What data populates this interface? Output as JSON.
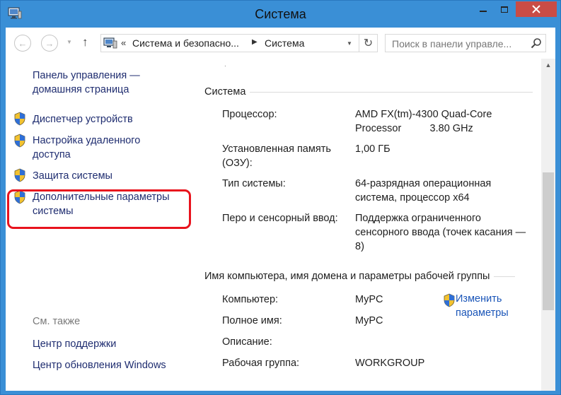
{
  "window": {
    "title": "Система",
    "colors": {
      "frame": "#3a8fd6",
      "close": "#c94c46",
      "highlight": "#e8131d",
      "link": "#1f2d70",
      "accent_link": "#1a55b8"
    }
  },
  "nav": {
    "back_icon": "←",
    "forward_icon": "→",
    "recent_icon": "▼",
    "up_icon": "↑",
    "refresh_icon": "↻",
    "address": {
      "overflow": "«",
      "crumbs": [
        "Система и безопасно...",
        "Система"
      ],
      "separator": "▶",
      "dropdown": "▼"
    },
    "search_placeholder": "Поиск в панели управле..."
  },
  "sidebar": {
    "home_link": "Панель управления — домашняя страница",
    "tasks": [
      {
        "label": "Диспетчер устройств"
      },
      {
        "label": "Настройка удаленного доступа"
      },
      {
        "label": "Защита системы"
      },
      {
        "label": "Дополнительные параметры системы"
      }
    ],
    "see_also_title": "См. также",
    "see_also": [
      {
        "label": "Центр поддержки"
      },
      {
        "label": "Центр обновления Windows"
      }
    ]
  },
  "main": {
    "system_section": {
      "title": "Система",
      "rows": [
        {
          "label": "Процессор:",
          "value": "AMD FX(tm)-4300 Quad-Core Processor          3.80 GHz"
        },
        {
          "label": "Установленная память (ОЗУ):",
          "value": "1,00 ГБ"
        },
        {
          "label": "Тип системы:",
          "value": "64-разрядная операционная система, процессор x64"
        },
        {
          "label": "Перо и сенсорный ввод:",
          "value": "Поддержка ограниченного сенсорного ввода (точек касания — 8)"
        }
      ]
    },
    "computer_section": {
      "title": "Имя компьютера, имя домена и параметры рабочей группы",
      "rows": [
        {
          "label": "Компьютер:",
          "value": "MyPC"
        },
        {
          "label": "Полное имя:",
          "value": "MyPC"
        },
        {
          "label": "Описание:",
          "value": ""
        },
        {
          "label": "Рабочая группа:",
          "value": "WORKGROUP"
        }
      ],
      "change_link": "Изменить параметры"
    }
  },
  "scrollbar": {
    "up_arrow": "▲"
  }
}
